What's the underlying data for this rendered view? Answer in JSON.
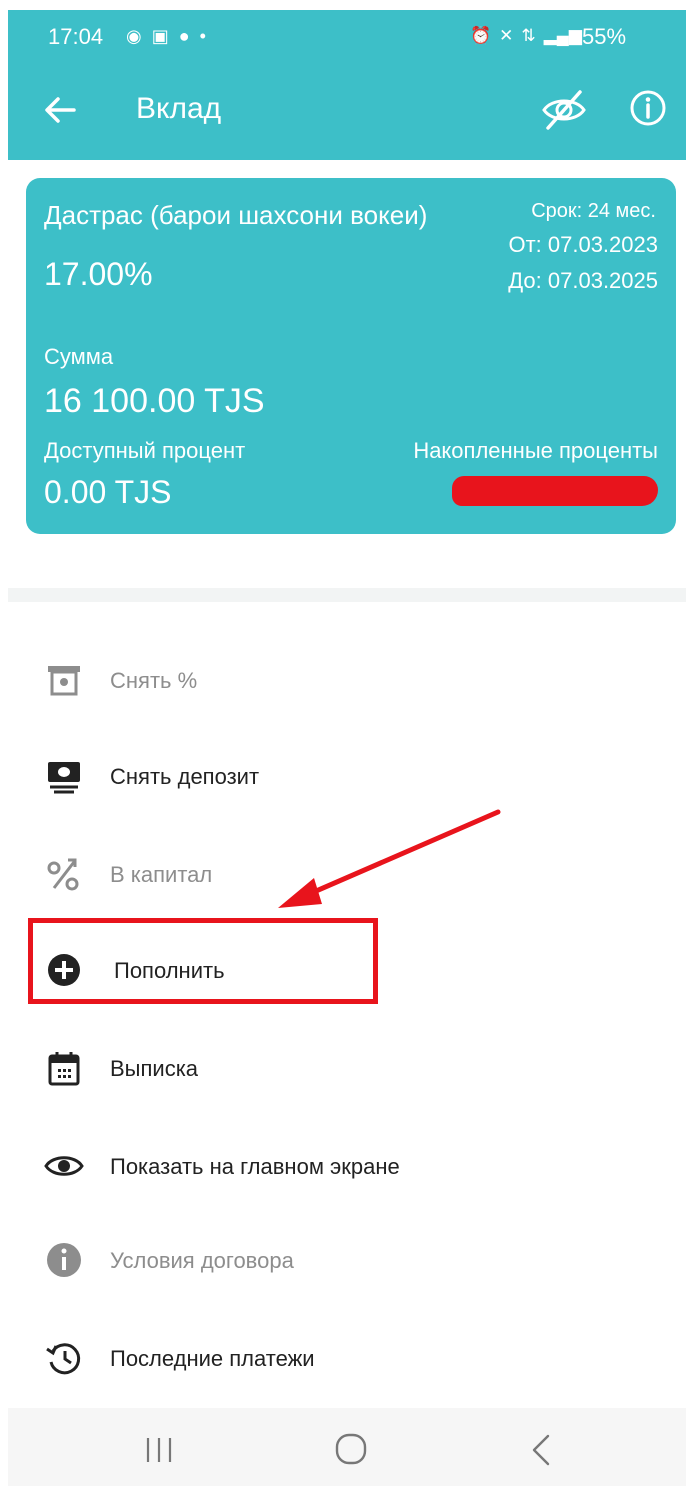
{
  "status_bar": {
    "time": "17:04",
    "battery": "55%",
    "left_icons": [
      "signal-circle-icon",
      "gallery-icon",
      "chat-icon",
      "dot-icon"
    ],
    "right_icons": [
      "alarm-icon",
      "mute-icon",
      "data-icon",
      "cellular-icon"
    ]
  },
  "header": {
    "title": "Вклад",
    "back_icon": "arrow-left-icon",
    "hide_icon": "eye-off-icon",
    "info_icon": "info-icon",
    "background": "#3dbfc8"
  },
  "card": {
    "name": "Дастрас (барои шахсони вокеи)",
    "rate": "17.00%",
    "term": "Срок: 24 мес.",
    "from": "От: 07.03.2023",
    "to": "До: 07.03.2025",
    "sum_label": "Сумма",
    "sum_value": "16 100.00 TJS",
    "available_label": "Доступный процент",
    "available_value": "0.00 TJS",
    "accumulated_label": "Накопленные проценты",
    "accumulated_value_redacted_color": "#e8141c"
  },
  "menu": {
    "items": [
      {
        "label": "Снять %",
        "icon": "atm-withdraw-icon",
        "enabled": false
      },
      {
        "label": "Снять депозит",
        "icon": "cash-withdraw-icon",
        "enabled": true
      },
      {
        "label": "В капитал",
        "icon": "percent-up-icon",
        "enabled": false
      },
      {
        "label": "Пополнить",
        "icon": "plus-circle-icon",
        "enabled": true
      },
      {
        "label": "Выписка",
        "icon": "calendar-icon",
        "enabled": true
      },
      {
        "label": "Показать на главном экране",
        "icon": "eye-icon",
        "enabled": true
      },
      {
        "label": "Условия договора",
        "icon": "info-filled-icon",
        "enabled": false
      },
      {
        "label": "Последние платежи",
        "icon": "history-icon",
        "enabled": true
      }
    ],
    "highlight_color": "#e8141c"
  },
  "navbar": {
    "icons": [
      "recents-icon",
      "home-icon",
      "back-icon"
    ]
  }
}
